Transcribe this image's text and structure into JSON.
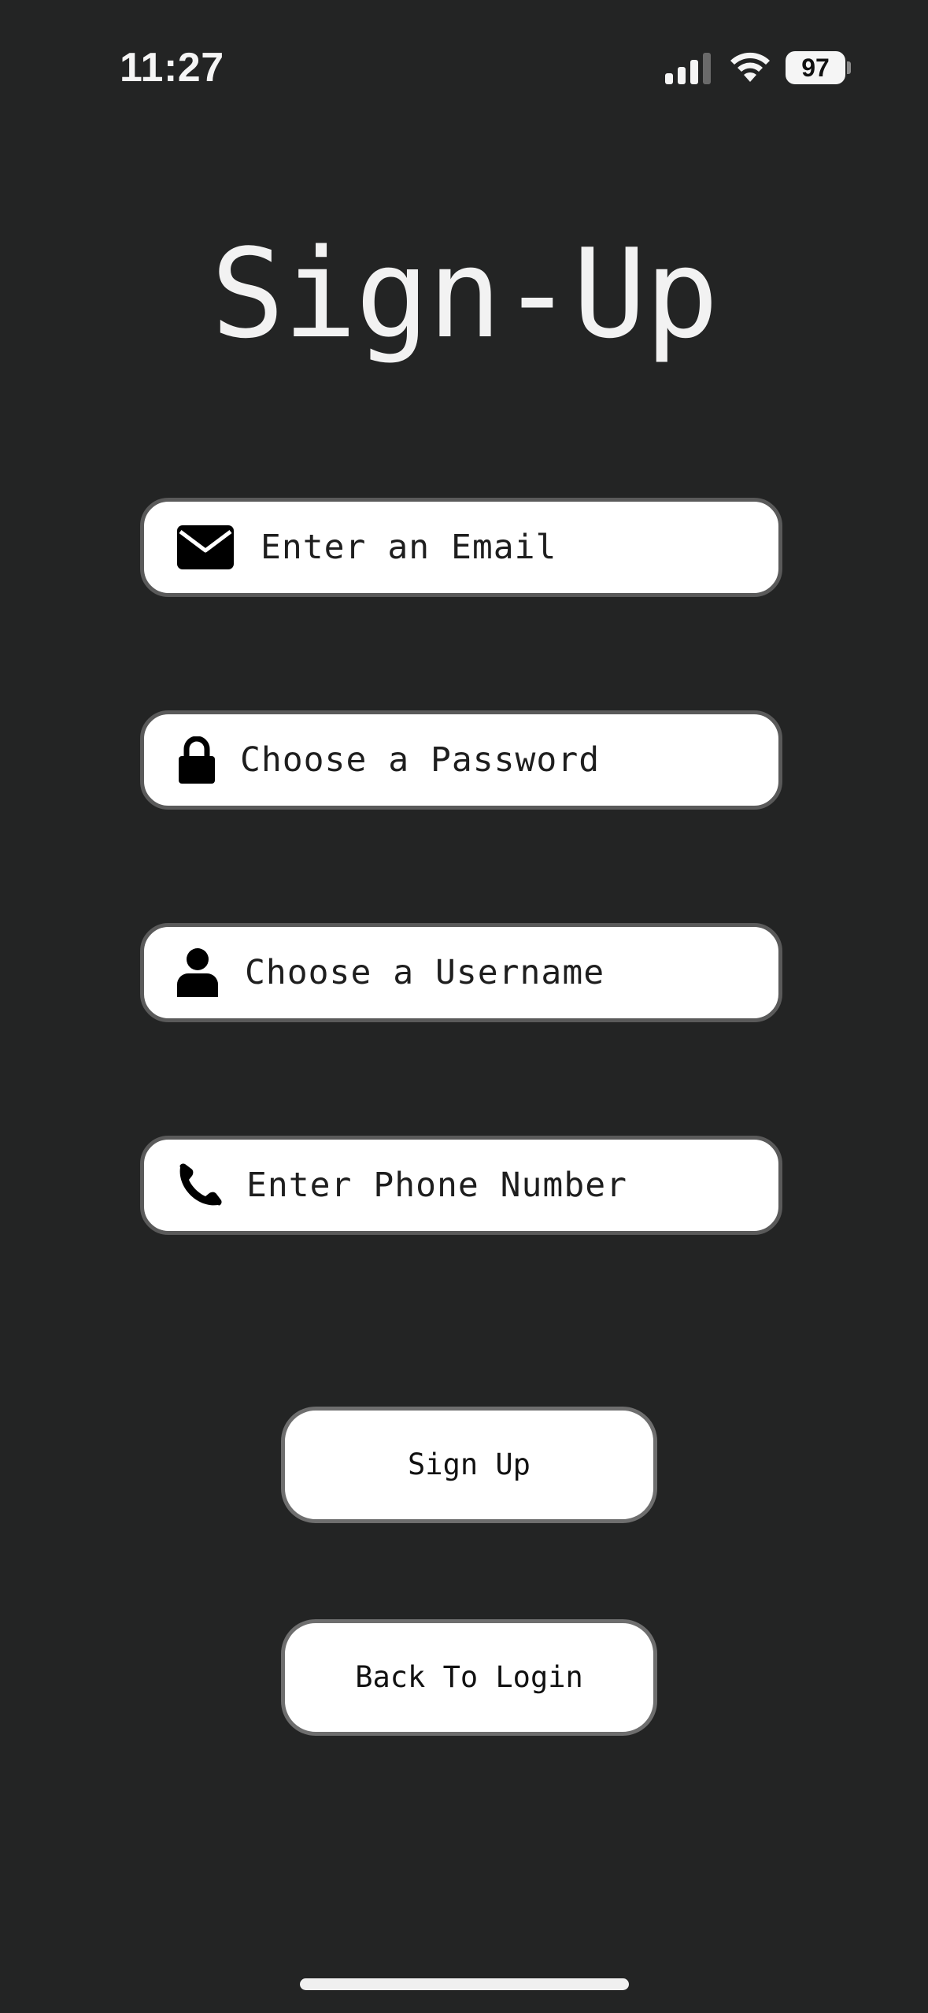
{
  "status_bar": {
    "time": "11:27",
    "battery_level": "97",
    "icons": [
      "cellular-signal-icon",
      "wifi-icon",
      "battery-icon"
    ]
  },
  "title": "Sign-Up",
  "fields": {
    "email": {
      "placeholder": "Enter an Email",
      "value": "",
      "icon": "envelope-icon"
    },
    "password": {
      "placeholder": "Choose a Password",
      "value": "",
      "icon": "lock-icon"
    },
    "username": {
      "placeholder": "Choose a Username",
      "value": "",
      "icon": "person-icon"
    },
    "phone": {
      "placeholder": "Enter Phone Number",
      "value": "",
      "icon": "phone-icon"
    }
  },
  "buttons": {
    "signup_label": "Sign Up",
    "back_label": "Back To Login"
  },
  "colors": {
    "background": "#232424",
    "field_background": "#ffffff",
    "field_border": "#5a5a5a",
    "text_light": "#f2f2f2"
  }
}
